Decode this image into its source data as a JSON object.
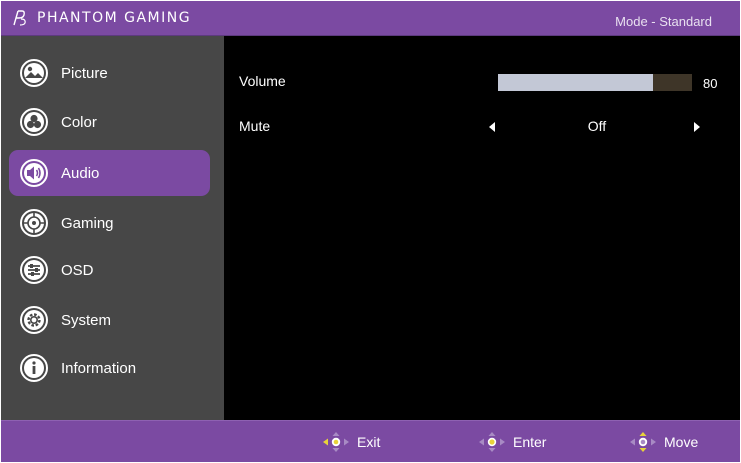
{
  "header": {
    "brand": "PHANTOM GAMING",
    "mode": "Mode - Standard"
  },
  "colors": {
    "accent": "#7b4aa2",
    "sidebar_bg": "#474747",
    "content_bg": "#000000",
    "slider_fill": "#c3c8d6",
    "slider_track": "#3e3528",
    "nav_highlight": "#e8d33a"
  },
  "sidebar": {
    "items": [
      {
        "label": "Picture",
        "icon": "picture-icon"
      },
      {
        "label": "Color",
        "icon": "color-icon"
      },
      {
        "label": "Audio",
        "icon": "audio-icon",
        "active": true
      },
      {
        "label": "Gaming",
        "icon": "gaming-icon"
      },
      {
        "label": "OSD",
        "icon": "osd-icon"
      },
      {
        "label": "System",
        "icon": "system-icon"
      },
      {
        "label": "Information",
        "icon": "information-icon"
      }
    ]
  },
  "audio": {
    "volume": {
      "label": "Volume",
      "value": "80",
      "percent": 80
    },
    "mute": {
      "label": "Mute",
      "value": "Off"
    }
  },
  "footer": {
    "exit": "Exit",
    "enter": "Enter",
    "move": "Move"
  }
}
